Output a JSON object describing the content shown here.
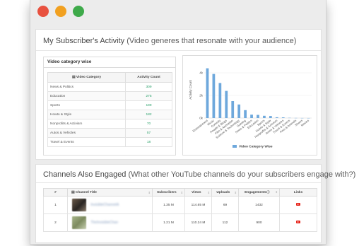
{
  "activity": {
    "title": "My Subscriber's Activity",
    "subtitle": "(Video generes that resonate with your audience)",
    "table": {
      "heading": "Video category wise",
      "col_category": "Video Category",
      "col_count": "Activity Count",
      "rows": [
        {
          "category": "News & Politics",
          "count": "309"
        },
        {
          "category": "Education",
          "count": "275"
        },
        {
          "category": "Sports",
          "count": "199"
        },
        {
          "category": "Howto & Style",
          "count": "182"
        },
        {
          "category": "Nonprofits & Activism",
          "count": "70"
        },
        {
          "category": "Autos & Vehicles",
          "count": "57"
        },
        {
          "category": "Travel & Events",
          "count": "18"
        }
      ]
    }
  },
  "chart_data": {
    "type": "bar",
    "categories": [
      "Entertainment",
      "Music",
      "Comedy",
      "People & Blogs",
      "Film & Animation",
      "Science & Technology",
      "Gaming",
      "News & Politics",
      "Education",
      "Sports",
      "Howto & Style",
      "Nonprofits & Activism",
      "Autos & Vehicles",
      "Travel & Events",
      "Pets & Animals",
      "Shows",
      "Movies"
    ],
    "series": [
      {
        "name": "Video Category Wise",
        "values": [
          4.4,
          3.9,
          3.1,
          2.4,
          1.5,
          1.2,
          0.7,
          0.3,
          0.28,
          0.2,
          0.18,
          0.07,
          0.06,
          0.02,
          0.01,
          0.005,
          0.003
        ]
      }
    ],
    "yticks": [
      "0k",
      "2k",
      "4k"
    ],
    "ylabel": "Activity Count",
    "ylim": [
      0,
      5
    ],
    "legend_position": "bottom",
    "bar_color": "#6ea8dc"
  },
  "channels": {
    "title": "Channels Also Engaged",
    "subtitle": "(What other YouTube channels do your subscribers engage with?)",
    "headers": [
      "#",
      "Channel Title",
      "Subscribers",
      "Views",
      "Uploads",
      "Engagements",
      "Links"
    ],
    "rows": [
      {
        "rank": "1",
        "name": "InvisibleChannelA",
        "subscribers": "1.35 M",
        "views": "114.65 M",
        "uploads": "69",
        "engagements": "1432"
      },
      {
        "rank": "2",
        "name": "TheInvisibleChan",
        "subscribers": "1.21 M",
        "views": "110.24 M",
        "uploads": "112",
        "engagements": "900"
      }
    ]
  }
}
